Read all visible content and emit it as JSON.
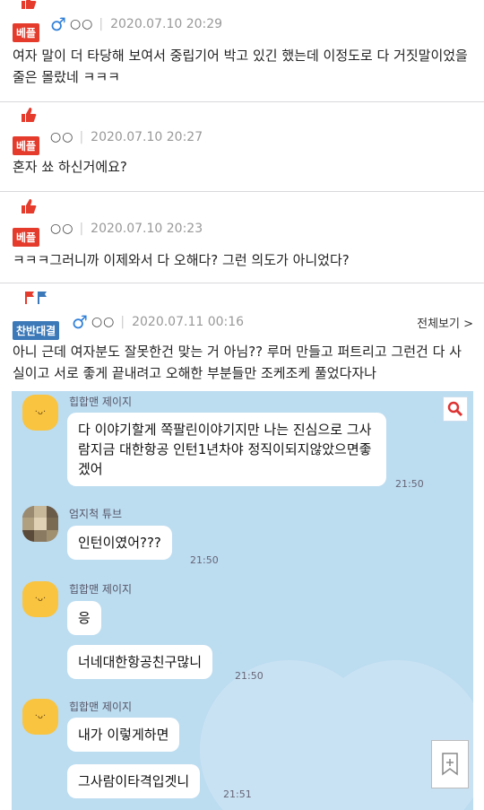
{
  "comments": [
    {
      "badge": "베플",
      "gender": "♂",
      "nick": "○○",
      "date": "2020.07.10 20:29",
      "text": "여자 말이 더 타당해 보여서 중립기어 박고 있긴 했는데 이정도로 다 거짓말이었을 줄은 몰랐네 ㅋㅋㅋ"
    },
    {
      "badge": "베플",
      "nick": "○○",
      "date": "2020.07.10 20:27",
      "text": "혼자 쑈 하신거에요?"
    },
    {
      "badge": "베플",
      "nick": "○○",
      "date": "2020.07.10 20:23",
      "text": "ㅋㅋㅋ그러니까 이제와서 다 오해다? 그런 의도가 아니었다?"
    },
    {
      "badge": "찬반대결",
      "gender": "♂",
      "nick": "○○",
      "date": "2020.07.11 00:16",
      "fullview": "전체보기 >",
      "text": "아니 근데 여자분도 잘못한건 맞는 거 아님?? 루머 만들고 퍼트리고 그런건 다 사실이고 서로 좋게 끝내려고 오해한 부분들만 조케조케 풀었다자나"
    }
  ],
  "chat": {
    "messages": [
      {
        "sender": "힙합맨 제이지",
        "bubbles": [
          "다 이야기할게   쪽팔린이야기지만 나는 진심으로 그사람지금 대한항공 인턴1년차야 정직이되지않았으면좋겠어"
        ],
        "time": "21:50"
      },
      {
        "sender": "엄지척 튜브",
        "bubbles": [
          "인턴이였어???"
        ],
        "time": "21:50"
      },
      {
        "sender": "힙합맨 제이지",
        "bubbles": [
          "응",
          "너네대한항공친구많니"
        ],
        "time": "21:50"
      },
      {
        "sender": "힙합맨 제이지",
        "bubbles": [
          "내가 이렇게하면",
          "그사람이타격입겟니"
        ],
        "time": "21:51"
      }
    ]
  },
  "icons": {
    "thumb": "thumbs-up-icon",
    "search": "search-icon",
    "bookmark": "bookmark-icon",
    "flag": "flag-icon"
  },
  "colors": {
    "badge_red": "#e53b2c",
    "badge_blue": "#3c79b8",
    "male": "#2f7fd8",
    "chat_bg": "#bcdcf0"
  }
}
